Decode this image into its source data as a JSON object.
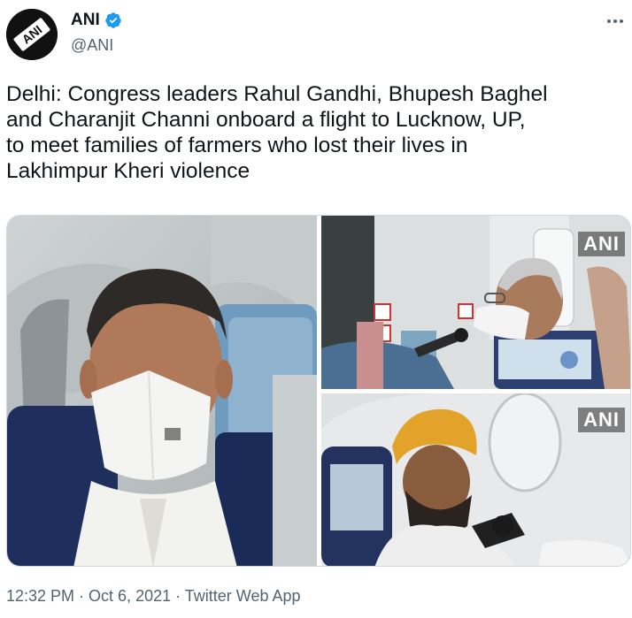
{
  "author": {
    "display_name": "ANI",
    "handle": "@ANI",
    "avatar_text": "ANI",
    "verified": true
  },
  "tweet": {
    "text": "Delhi: Congress leaders Rahul Gandhi, Bhupesh Baghel\nand Charanjit Channi onboard a flight to Lucknow, UP,\nto meet families of farmers who lost their lives in\nLakhimpur Kheri violence"
  },
  "media": {
    "photos": [
      {
        "watermark": ""
      },
      {
        "watermark": "ANI"
      },
      {
        "watermark": "ANI"
      }
    ]
  },
  "meta": {
    "time": "12:32 PM",
    "separator": " · ",
    "date": "Oct 6, 2021",
    "source": "Twitter Web App"
  },
  "colors": {
    "text": "#0f1419",
    "secondary": "#536471",
    "verified": "#1d9bf0",
    "border": "#cfd9de"
  }
}
